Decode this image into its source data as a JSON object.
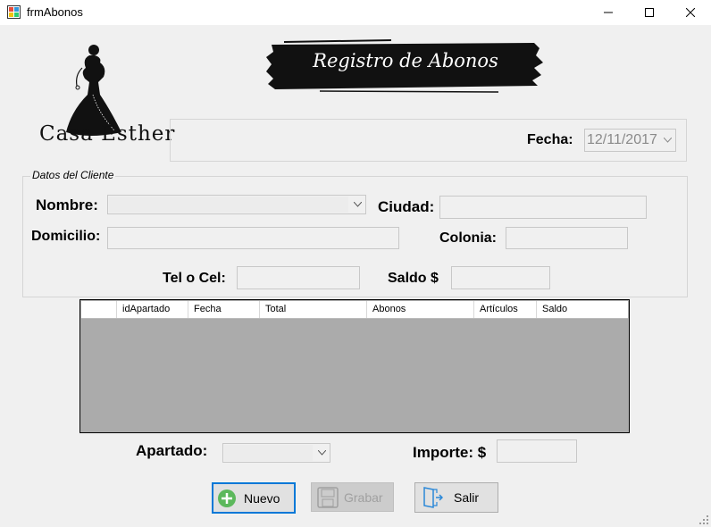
{
  "window": {
    "title": "frmAbonos",
    "controls": [
      "minimize-icon",
      "maximize-icon",
      "close-icon"
    ]
  },
  "branding": {
    "logo_text": "Casa  Esther",
    "banner_text": "Registro de Abonos"
  },
  "fecha": {
    "label": "Fecha:",
    "value": "12/11/2017"
  },
  "cliente": {
    "group_label": "Datos del Cliente",
    "nombre_label": "Nombre:",
    "nombre_value": "",
    "ciudad_label": "Ciudad:",
    "domicilio_label": "Domicilio:",
    "colonia_label": "Colonia:",
    "tel_label": "Tel o Cel:",
    "saldo_label": "Saldo $"
  },
  "grid": {
    "columns": [
      "",
      "idApartado",
      "Fecha",
      "Total",
      "Abonos",
      "Artículos",
      "Saldo"
    ]
  },
  "apartado": {
    "label": "Apartado:",
    "importe_label": "Importe: $"
  },
  "buttons": {
    "nuevo": "Nuevo",
    "grabar": "Grabar",
    "salir": "Salir"
  },
  "colors": {
    "background": "#f0f0f0",
    "grid_background": "#ababab",
    "accent": "#0078d7"
  }
}
